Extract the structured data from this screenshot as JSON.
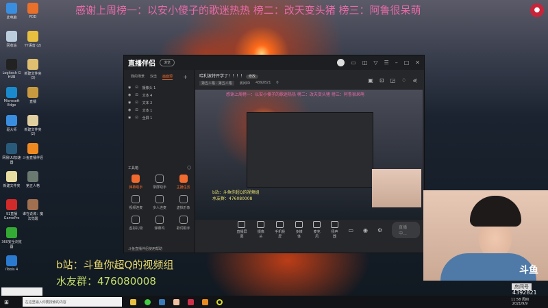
{
  "banner": "感谢上周榜一：以安小傻子的歌迷热热 榜二：改天变头猪 榜三：阿鲁很呆萌",
  "desktop_icons": [
    "此电脑",
    "PDD",
    "回收站",
    "YY语音 (2)",
    "Logitech G HUB",
    "新建文件夹 (3)",
    "Microsoft Edge",
    "直播",
    "驱大师",
    "新建文件夹 (2)",
    "网易UU加速器",
    "斗鱼直播伴侣",
    "新建文件夹",
    "第五人格",
    "91直播 GamePro",
    "谁在说谎：魔法觉醒",
    "360安全浏览器",
    "",
    "iTools 4",
    ""
  ],
  "app": {
    "title": "直播伴侣",
    "badge": "浏览",
    "tabs": [
      "我的场景",
      "双击",
      "画面源"
    ],
    "sources": [
      "摄像头 1",
      "文本 4",
      "文本 2",
      "文本 1",
      "全屏 1"
    ],
    "stream_title": "哈利波特开学了！！！！",
    "edit": "修改",
    "category": "第五人格 · 第五人格",
    "room_label": "房间ID",
    "room_id": "4392821",
    "hot": "0",
    "tools_title": "工具箱",
    "tools": [
      "弹幕助手",
      "录屏助手",
      "主播任务",
      "视频连麦",
      "多人连麦",
      "虚拟形象",
      "虚拟礼物",
      "弹幕鸡",
      "歌词助手"
    ],
    "footer": "斗鱼直播伴侣使用帮助",
    "bottom": [
      "直播屏幕",
      "摄像头",
      "手机投屏",
      "多媒体",
      "麦克风",
      "扬声器"
    ],
    "live": "直播中..."
  },
  "preview": {
    "b": "b站：斗鱼你超Q的视频组",
    "q": "水友群：476080008"
  },
  "overlay": {
    "b": "b站：斗鱼你超Q的视频组",
    "q": "水友群：476080008",
    "room_label": "房间号",
    "room_id": "4392821",
    "logo": "斗鱼"
  },
  "taskbar": {
    "search": "在这里输入你要搜索的内容",
    "time": "11:58 周四",
    "date": "2021/9/9"
  }
}
